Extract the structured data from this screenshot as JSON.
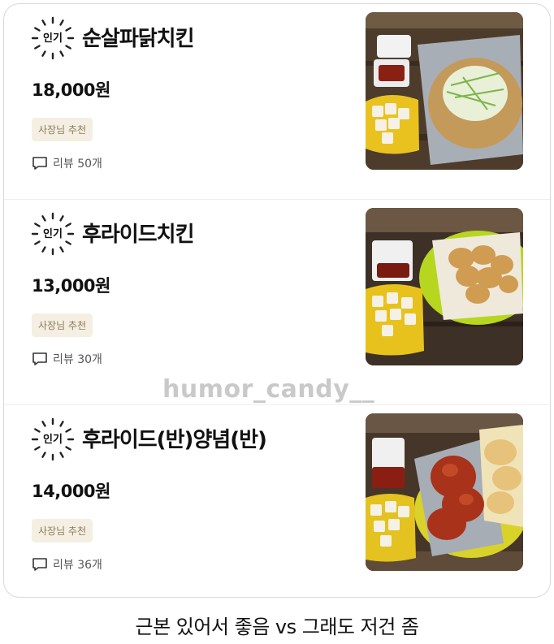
{
  "menu": {
    "items": [
      {
        "badge": "인기",
        "name": "순살파닭치킨",
        "price": "18,000원",
        "tag": "사장님 추천",
        "review": "리뷰 50개",
        "photo_icon": "boneless-chicken-with-green-onion-photo"
      },
      {
        "badge": "인기",
        "name": "후라이드치킨",
        "price": "13,000원",
        "tag": "사장님 추천",
        "review": "리뷰 30개",
        "photo_icon": "fried-chicken-photo"
      },
      {
        "badge": "인기",
        "name": "후라이드(반)양념(반)",
        "price": "14,000원",
        "tag": "사장님 추천",
        "review": "리뷰 36개",
        "photo_icon": "half-fried-half-seasoned-chicken-photo"
      }
    ]
  },
  "watermark": "humor_candy__",
  "caption": "근본 있어서 좋음 vs 그래도 저건 좀",
  "colors": {
    "tag_bg": "#f4efe2",
    "tag_text": "#8c7a57",
    "watermark": "#c9c9c9"
  }
}
